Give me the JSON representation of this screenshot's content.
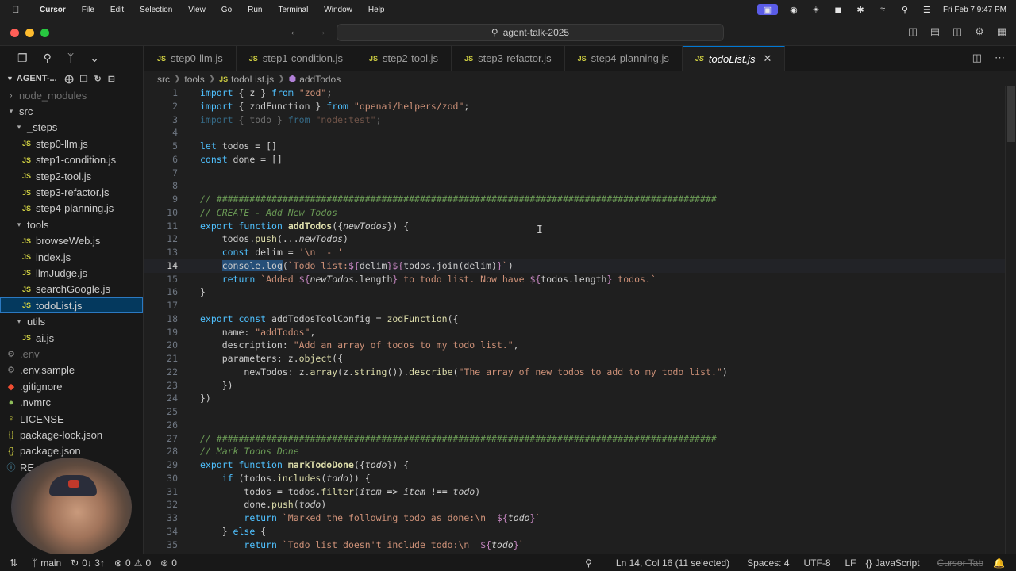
{
  "menubar": {
    "app": "Cursor",
    "items": [
      "File",
      "Edit",
      "Selection",
      "View",
      "Go",
      "Run",
      "Terminal",
      "Window",
      "Help"
    ],
    "clock": "Fri Feb 7  9:47 PM"
  },
  "titlebar": {
    "search_text": "agent-talk-2025"
  },
  "sidebar": {
    "title": "AGENT-...",
    "items": [
      {
        "label": "node_modules",
        "kind": "folder-closed",
        "depth": 1,
        "dim": true
      },
      {
        "label": "src",
        "kind": "folder-open",
        "depth": 1
      },
      {
        "label": "_steps",
        "kind": "folder-open",
        "depth": 2
      },
      {
        "label": "step0-llm.js",
        "kind": "js",
        "depth": 3
      },
      {
        "label": "step1-condition.js",
        "kind": "js",
        "depth": 3
      },
      {
        "label": "step2-tool.js",
        "kind": "js",
        "depth": 3
      },
      {
        "label": "step3-refactor.js",
        "kind": "js",
        "depth": 3
      },
      {
        "label": "step4-planning.js",
        "kind": "js",
        "depth": 3
      },
      {
        "label": "tools",
        "kind": "folder-open",
        "depth": 2
      },
      {
        "label": "browseWeb.js",
        "kind": "js",
        "depth": 3
      },
      {
        "label": "index.js",
        "kind": "js",
        "depth": 3
      },
      {
        "label": "llmJudge.js",
        "kind": "js",
        "depth": 3
      },
      {
        "label": "searchGoogle.js",
        "kind": "js",
        "depth": 3
      },
      {
        "label": "todoList.js",
        "kind": "js",
        "depth": 3,
        "selected": true
      },
      {
        "label": "utils",
        "kind": "folder-open",
        "depth": 2
      },
      {
        "label": "ai.js",
        "kind": "js",
        "depth": 3
      },
      {
        "label": ".env",
        "kind": "gear",
        "depth": 1,
        "dim": true
      },
      {
        "label": ".env.sample",
        "kind": "gear",
        "depth": 1
      },
      {
        "label": ".gitignore",
        "kind": "git",
        "depth": 1
      },
      {
        "label": ".nvmrc",
        "kind": "dot",
        "depth": 1
      },
      {
        "label": "LICENSE",
        "kind": "license",
        "depth": 1
      },
      {
        "label": "package-lock.json",
        "kind": "json",
        "depth": 1
      },
      {
        "label": "package.json",
        "kind": "json",
        "depth": 1
      },
      {
        "label": "RE",
        "kind": "info",
        "depth": 1
      }
    ]
  },
  "tabs": [
    {
      "label": "step0-llm.js"
    },
    {
      "label": "step1-condition.js"
    },
    {
      "label": "step2-tool.js"
    },
    {
      "label": "step3-refactor.js"
    },
    {
      "label": "step4-planning.js"
    },
    {
      "label": "todoList.js",
      "active": true
    }
  ],
  "breadcrumb": [
    "src",
    "tools",
    "todoList.js",
    "addTodos"
  ],
  "editor": {
    "current_line": 14,
    "lines": [
      {
        "n": "1",
        "html": "<span class='k'>import</span> { <span class='vr'>z</span> } <span class='k'>from</span> <span class='st'>\"zod\"</span>;"
      },
      {
        "n": "2",
        "html": "<span class='k'>import</span> { <span class='vr'>zodFunction</span> } <span class='k'>from</span> <span class='st'>\"openai/helpers/zod\"</span>;"
      },
      {
        "n": "3",
        "html": "<span class='dimline'><span class='k'>import</span> { todo } <span class='k'>from</span> <span class='st'>\"node:test\"</span>;</span>"
      },
      {
        "n": "4",
        "html": ""
      },
      {
        "n": "5",
        "html": "<span class='k'>let</span> todos = []"
      },
      {
        "n": "6",
        "html": "<span class='k'>const</span> done = []"
      },
      {
        "n": "7",
        "html": ""
      },
      {
        "n": "8",
        "html": ""
      },
      {
        "n": "9",
        "html": "<span class='cm'>// ###########################################################################################</span>"
      },
      {
        "n": "10",
        "html": "<span class='cm'>// CREATE - Add New Todos</span>"
      },
      {
        "n": "11",
        "html": "<span class='k'>export</span> <span class='k'>function</span> <span class='fn'>addTodos</span>({<span class='it'>newTodos</span>}) {"
      },
      {
        "n": "12",
        "html": "    todos.<span class='fn' style='font-weight:normal'>push</span>(...<span class='it'>newTodos</span>)"
      },
      {
        "n": "13",
        "html": "    <span class='k'>const</span> delim = <span class='st'>'\\n  - '</span>"
      },
      {
        "n": "14",
        "html": "    <span class='sel'>console.log</span>(<span class='st'>`Todo list:</span><span class='pr'>${</span>delim<span class='pr'>}${</span>todos.join(delim)<span class='pr'>}</span><span class='st'>`</span>)"
      },
      {
        "n": "15",
        "html": "    <span class='k'>return</span> <span class='st'>`Added </span><span class='pr'>${</span><span class='it'>newTodos</span>.length<span class='pr'>}</span><span class='st'> to todo list. Now have </span><span class='pr'>${</span>todos.length<span class='pr'>}</span><span class='st'> todos.`</span>"
      },
      {
        "n": "16",
        "html": "}"
      },
      {
        "n": "17",
        "html": ""
      },
      {
        "n": "18",
        "html": "<span class='k'>export</span> <span class='k'>const</span> addTodosToolConfig = <span class='fn' style='font-weight:normal'>zodFunction</span>({"
      },
      {
        "n": "19",
        "html": "    name: <span class='st'>\"addTodos\"</span>,"
      },
      {
        "n": "20",
        "html": "    description: <span class='st'>\"Add an array of todos to my todo list.\"</span>,"
      },
      {
        "n": "21",
        "html": "    parameters: z.<span class='fn' style='font-weight:normal'>object</span>({"
      },
      {
        "n": "22",
        "html": "        newTodos: z.<span class='fn' style='font-weight:normal'>array</span>(z.<span class='fn' style='font-weight:normal'>string</span>()).<span class='fn' style='font-weight:normal'>describe</span>(<span class='st'>\"The array of new todos to add to my todo list.\"</span>)"
      },
      {
        "n": "23",
        "html": "    })"
      },
      {
        "n": "24",
        "html": "})"
      },
      {
        "n": "25",
        "html": ""
      },
      {
        "n": "26",
        "html": ""
      },
      {
        "n": "27",
        "html": "<span class='cm'>// ###########################################################################################</span>"
      },
      {
        "n": "28",
        "html": "<span class='cm'>// Mark Todos Done</span>"
      },
      {
        "n": "29",
        "html": "<span class='k'>export</span> <span class='k'>function</span> <span class='fn'>markTodoDone</span>({<span class='it'>todo</span>}) {"
      },
      {
        "n": "30",
        "html": "    <span class='k'>if</span> (todos.<span class='fn' style='font-weight:normal'>includes</span>(<span class='it'>todo</span>)) {"
      },
      {
        "n": "31",
        "html": "        todos = todos.<span class='fn' style='font-weight:normal'>filter</span>(<span class='it'>item</span> => <span class='it'>item</span> !== <span class='it'>todo</span>)"
      },
      {
        "n": "32",
        "html": "        done.<span class='fn' style='font-weight:normal'>push</span>(<span class='it'>todo</span>)"
      },
      {
        "n": "33",
        "html": "        <span class='k'>return</span> <span class='st'>`Marked the following todo as done:\\n  </span><span class='pr'>${</span><span class='it'>todo</span><span class='pr'>}</span><span class='st'>`</span>"
      },
      {
        "n": "34",
        "html": "    } <span class='k'>else</span> {"
      },
      {
        "n": "35",
        "html": "        <span class='k'>return</span> <span class='st'>`Todo list doesn't include todo:\\n  </span><span class='pr'>${</span><span class='it'>todo</span><span class='pr'>}</span><span class='st'>`</span>"
      }
    ]
  },
  "statusbar": {
    "branch": "main",
    "sync": "0↓ 3↑",
    "errors": "0",
    "warnings": "0",
    "ports": "0",
    "position": "Ln 14, Col 16 (11 selected)",
    "spaces": "Spaces: 4",
    "encoding": "UTF-8",
    "eol": "LF",
    "language": "JavaScript",
    "cursor_tab": "Cursor Tab"
  }
}
